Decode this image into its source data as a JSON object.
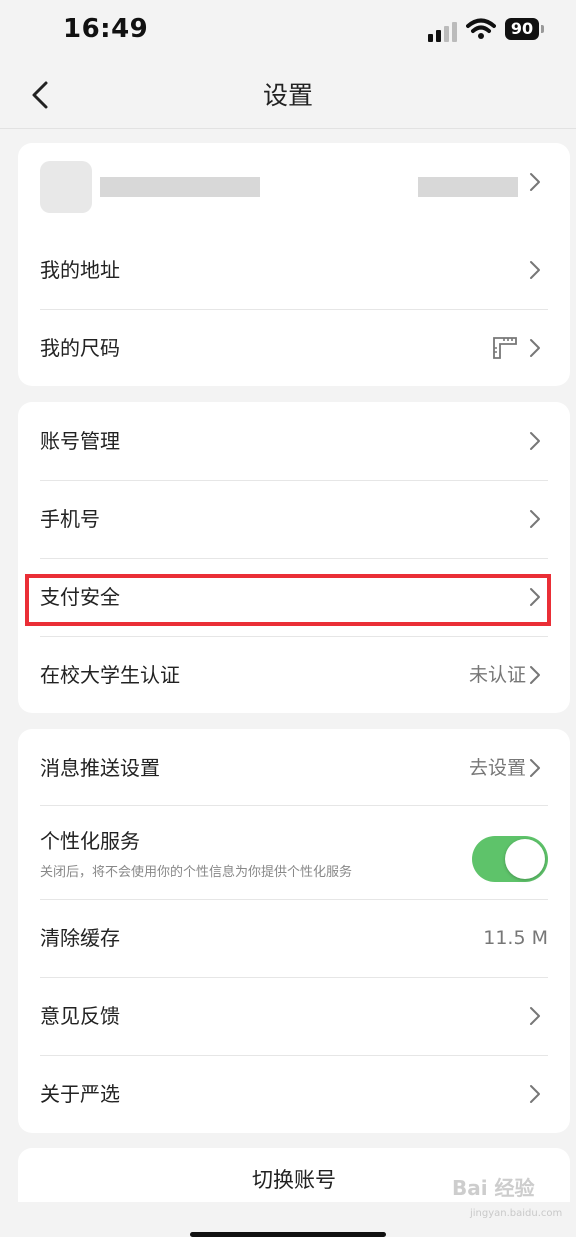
{
  "status_bar": {
    "time": "16:49",
    "battery": "90"
  },
  "nav": {
    "title": "设置"
  },
  "group1": {
    "items": [
      {
        "label": "我的地址"
      },
      {
        "label": "我的尺码"
      }
    ]
  },
  "group2": {
    "items": [
      {
        "label": "账号管理"
      },
      {
        "label": "手机号"
      },
      {
        "label": "支付安全"
      },
      {
        "label": "在校大学生认证",
        "value": "未认证"
      }
    ]
  },
  "group3": {
    "items": [
      {
        "label": "消息推送设置",
        "value": "去设置"
      },
      {
        "label": "个性化服务",
        "sublabel": "关闭后，将不会使用你的个性信息为你提供个性化服务",
        "toggle_on": true
      },
      {
        "label": "清除缓存",
        "value": "11.5 M"
      },
      {
        "label": "意见反馈"
      },
      {
        "label": "关于严选"
      }
    ]
  },
  "footer": {
    "switch_account": "切换账号"
  },
  "watermark": {
    "text": "Bai 经验",
    "sub": "jingyan.baidu.com"
  },
  "colors": {
    "accent_toggle": "#5ec36a",
    "highlight": "#ea2e36"
  }
}
